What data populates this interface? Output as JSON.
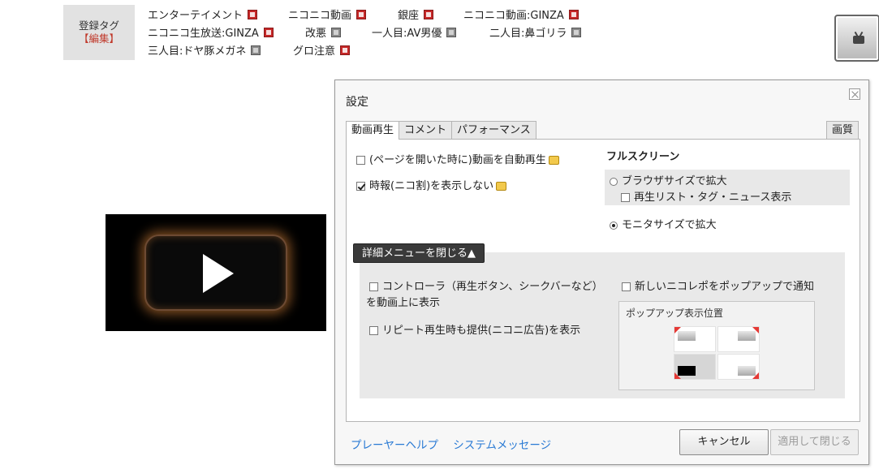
{
  "tags": {
    "label": "登録タグ",
    "edit": "【編集】",
    "rows": [
      [
        {
          "name": "エンターテイメント",
          "icon": "dictionary-icon"
        },
        {
          "name": "ニコニコ動画",
          "icon": "dictionary-icon"
        },
        {
          "name": "銀座",
          "icon": "dictionary-icon"
        },
        {
          "name": "ニコニコ動画:GINZA",
          "icon": "dictionary-icon"
        }
      ],
      [
        {
          "name": "ニコニコ生放送:GINZA",
          "icon": "dictionary-icon"
        },
        {
          "name": "改悪",
          "icon": "no-dictionary-icon"
        },
        {
          "name": "一人目:AV男優",
          "icon": "no-dictionary-icon"
        },
        {
          "name": "二人目:鼻ゴリラ",
          "icon": "no-dictionary-icon"
        }
      ],
      [
        {
          "name": "三人目:ドヤ豚メガネ",
          "icon": "no-dictionary-icon"
        },
        {
          "name": "グロ注意",
          "icon": "dictionary-icon"
        }
      ]
    ]
  },
  "player": {
    "play_icon": "play-icon"
  },
  "tv_button": {
    "icon": "tv-icon"
  },
  "dialog": {
    "title": "設定",
    "tabs": [
      "動画再生",
      "コメント",
      "パフォーマンス"
    ],
    "quality_tab": "画質",
    "playback": {
      "autoplay": {
        "label": "(ページを開いた時に)動画を自動再生",
        "checked": false
      },
      "jihou": {
        "label": "時報(ニコ割)を表示しない",
        "checked": true
      }
    },
    "fullscreen": {
      "heading": "フルスクリーン",
      "browser_size": {
        "label": "ブラウザサイズで拡大",
        "selected": false
      },
      "show_lists": {
        "label": "再生リスト・タグ・ニュース表示",
        "checked": false
      },
      "monitor_size": {
        "label": "モニタサイズで拡大",
        "selected": true
      }
    },
    "detail_toggle": "詳細メニューを閉じる▲",
    "detail": {
      "controller_line1": "コントローラ（再生ボタン、シークバーなど）",
      "controller_line2": "を動画上に表示",
      "repeat": "リピート再生時も提供(ニコニ広告)を表示",
      "nicorepo_popup": "新しいニコレポをポップアップで通知",
      "popup_position_title": "ポップアップ表示位置",
      "popup_selected": "bottom-left"
    },
    "links": [
      "プレーヤーヘルプ",
      "システムメッセージ"
    ],
    "cancel": "キャンセル",
    "apply": "適用して閉じる"
  }
}
